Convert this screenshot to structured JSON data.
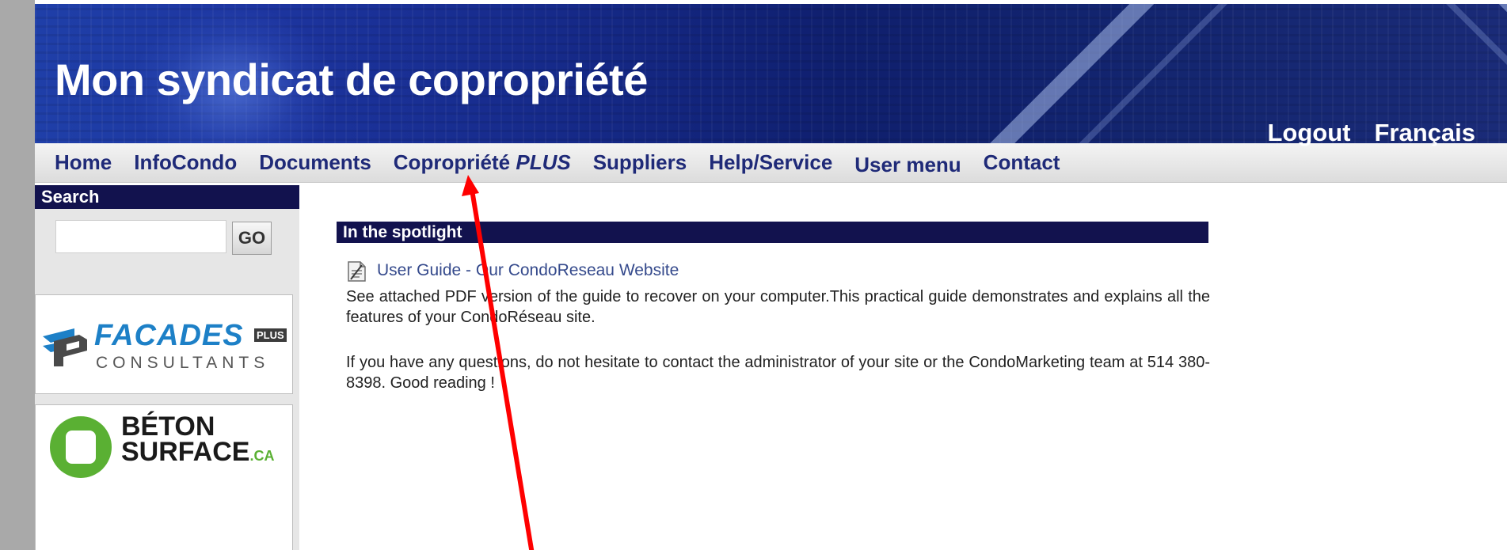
{
  "header": {
    "site_title": "Mon syndicat de copropriété",
    "logout_label": "Logout",
    "language_label": "Français"
  },
  "nav": {
    "items": [
      {
        "label": "Home"
      },
      {
        "label": "InfoCondo"
      },
      {
        "label": "Documents"
      },
      {
        "label": "Copropriété",
        "suffix": "PLUS"
      },
      {
        "label": "Suppliers"
      },
      {
        "label": "Help/Service"
      },
      {
        "label": "User menu"
      },
      {
        "label": "Contact"
      }
    ]
  },
  "sidebar": {
    "search_title": "Search",
    "search_value": "",
    "go_label": "GO",
    "ads": [
      {
        "brand": "FACADES",
        "badge": "PLUS",
        "subtitle": "CONSULTANTS"
      },
      {
        "line1": "BÉTON",
        "line2": "SURFACE",
        "suffix": ".CA"
      }
    ]
  },
  "main": {
    "spotlight_title": "In the spotlight",
    "guide_link": "User Guide - Our CondoReseau Website",
    "paragraph1": "See attached PDF version of the guide to recover on your computer.This practical guide demonstrates and explains all the features of your CondoRéseau site.",
    "paragraph2": "If you have any questions, do not hesitate to contact the administrator of your site or the CondoMarketing team at 514 380-8398. Good reading !"
  },
  "colors": {
    "nav_text": "#1f2a78",
    "section_header_bg": "#12124e",
    "annotation_arrow": "#ff0000"
  },
  "icons": {
    "document": "document-icon",
    "annotation": "red-arrow-annotation"
  }
}
